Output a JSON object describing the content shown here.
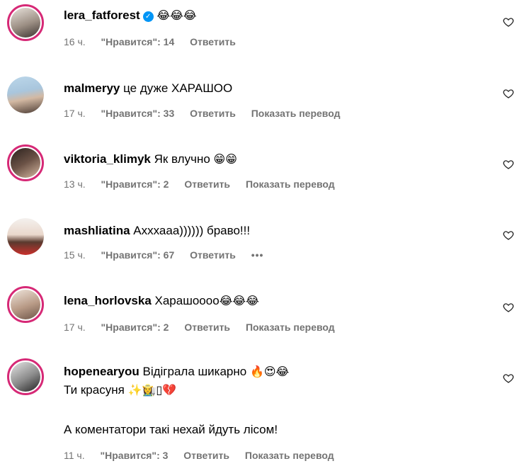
{
  "comments": [
    {
      "username": "lera_fatforest",
      "text": "",
      "emoji": "😂😂😂",
      "time": "16 ч.",
      "likes": "\"Нравится\": 14",
      "reply": "Ответить",
      "translate": "",
      "story_ring": true,
      "verified": true
    },
    {
      "username": "malmeryy",
      "text": "це дуже ХАРАШОО",
      "emoji": "",
      "time": "17 ч.",
      "likes": "\"Нравится\": 33",
      "reply": "Ответить",
      "translate": "Показать перевод",
      "story_ring": false
    },
    {
      "username": "viktoria_klimyk",
      "text": "Як влучно",
      "emoji": "😁😁",
      "time": "13 ч.",
      "likes": "\"Нравится\": 2",
      "reply": "Ответить",
      "translate": "Показать перевод",
      "story_ring": true
    },
    {
      "username": "mashliatina",
      "text": "Ахххааа)))))) браво!!!",
      "emoji": "",
      "time": "15 ч.",
      "likes": "\"Нравится\": 67",
      "reply": "Ответить",
      "more": "•••",
      "story_ring": false
    },
    {
      "username": "lena_horlovska",
      "text": "Харашоооо",
      "emoji": "😂😂😂",
      "time": "17 ч.",
      "likes": "\"Нравится\": 2",
      "reply": "Ответить",
      "translate": "Показать перевод",
      "story_ring": true
    },
    {
      "username": "hopenearyou",
      "text": "Відіграла шикарно",
      "emoji": "🔥😍😂",
      "line2_text": "Ти красуня",
      "line2_emoji": "✨👩‍🌾▯💔",
      "line3_text": "А коментатори такі нехай йдуть лісом!",
      "time": "11 ч.",
      "likes": "\"Нравится\": 3",
      "reply": "Ответить",
      "translate": "Показать перевод",
      "story_ring": true
    }
  ],
  "colors": {
    "story_ring": "#d62976",
    "verified": "#0095f6",
    "meta_text": "#737373"
  },
  "icons": {
    "like": "heart-outline-icon"
  }
}
